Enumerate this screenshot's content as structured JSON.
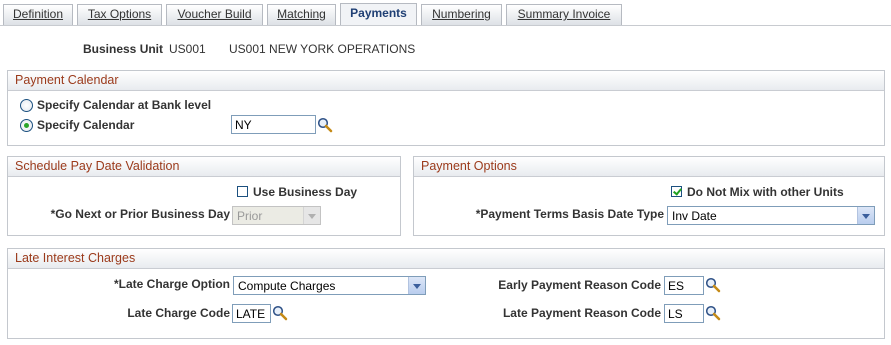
{
  "tabs": [
    {
      "label": "Definition",
      "active": false
    },
    {
      "label": "Tax Options",
      "active": false
    },
    {
      "label": "Voucher Build",
      "active": false
    },
    {
      "label": "Matching",
      "active": false
    },
    {
      "label": "Payments",
      "active": true
    },
    {
      "label": "Numbering",
      "active": false
    },
    {
      "label": "Summary Invoice",
      "active": false
    }
  ],
  "business_unit": {
    "label": "Business Unit",
    "code": "US001",
    "description": "US001 NEW YORK OPERATIONS"
  },
  "payment_calendar": {
    "title": "Payment Calendar",
    "bank_level_label": "Specify Calendar at Bank level",
    "bank_level_selected": false,
    "specify_label": "Specify Calendar",
    "specify_selected": true,
    "calendar_value": "NY"
  },
  "schedule_validation": {
    "title": "Schedule Pay Date Validation",
    "use_business_day_label": "Use Business Day",
    "use_business_day_checked": false,
    "go_next_label": "*Go Next or Prior Business Day",
    "go_next_value": "Prior"
  },
  "payment_options": {
    "title": "Payment Options",
    "do_not_mix_label": "Do Not Mix with other Units",
    "do_not_mix_checked": true,
    "terms_basis_label": "*Payment Terms Basis Date Type",
    "terms_basis_value": "Inv Date"
  },
  "late_interest": {
    "title": "Late Interest Charges",
    "late_option_label": "*Late Charge Option",
    "late_option_value": "Compute Charges",
    "late_code_label": "Late Charge Code",
    "late_code_value": "LATE",
    "early_reason_label": "Early Payment Reason Code",
    "early_reason_value": "ES",
    "late_reason_label": "Late Payment Reason Code",
    "late_reason_value": "LS"
  },
  "icons": {
    "lookup": "magnifier-lookup-icon",
    "dropdown": "chevron-down-icon"
  },
  "colors": {
    "group_title": "#9b3a1b",
    "active_tab_text": "#1f3f74",
    "checkmark": "#21a121"
  }
}
